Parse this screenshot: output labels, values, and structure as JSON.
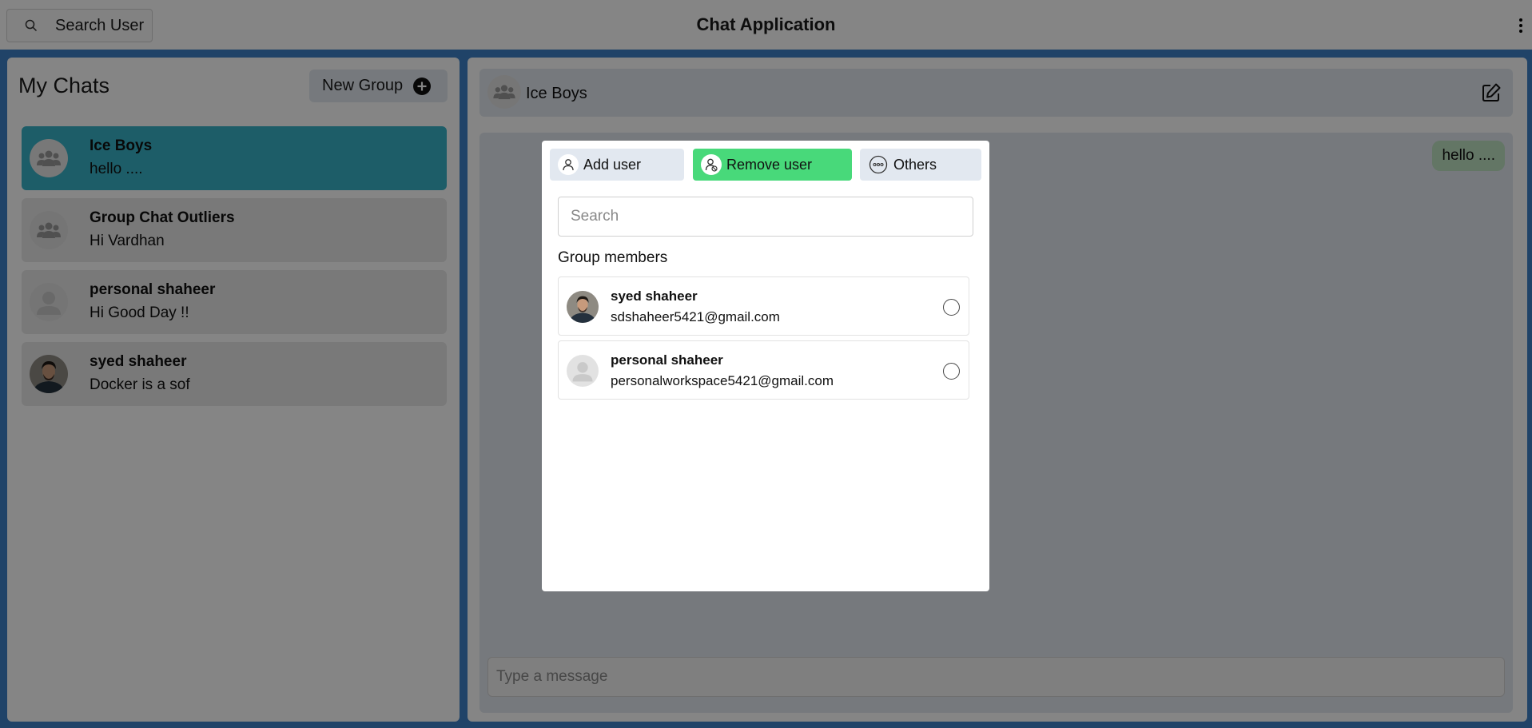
{
  "topbar": {
    "search_label": "Search User",
    "title": "Chat Application"
  },
  "sidebar": {
    "title": "My Chats",
    "new_group_label": "New Group",
    "chats": [
      {
        "name": "Ice Boys",
        "last_message": "hello ....",
        "avatar": "group-icon",
        "active": true
      },
      {
        "name": "Group Chat Outliers",
        "last_message": "Hi Vardhan",
        "avatar": "group-icon",
        "active": false
      },
      {
        "name": "personal shaheer",
        "last_message": "Hi Good Day !!",
        "avatar": "user-placeholder-icon",
        "active": false
      },
      {
        "name": "syed shaheer",
        "last_message": "Docker is a sof",
        "avatar": "user-photo",
        "active": false
      }
    ]
  },
  "chat": {
    "name": "Ice Boys",
    "messages": [
      {
        "text": "hello ....",
        "own": true
      }
    ],
    "input_placeholder": "Type a message"
  },
  "modal": {
    "tabs": [
      {
        "label": "Add user",
        "icon": "user-icon"
      },
      {
        "label": "Remove user",
        "icon": "user-remove-icon",
        "active": true
      },
      {
        "label": "Others",
        "icon": "more-icon"
      }
    ],
    "search_placeholder": "Search",
    "section_label": "Group members",
    "members": [
      {
        "name": "syed shaheer",
        "email": "sdshaheer5421@gmail.com",
        "avatar": "user-photo",
        "selected": false
      },
      {
        "name": "personal shaheer",
        "email": "personalworkspace5421@gmail.com",
        "avatar": "user-placeholder-icon",
        "selected": false
      }
    ]
  },
  "colors": {
    "background": "#3f80c8",
    "active_chat": "#38b2c7",
    "active_tab": "#48d97a",
    "own_bubble": "#bee3c1"
  }
}
